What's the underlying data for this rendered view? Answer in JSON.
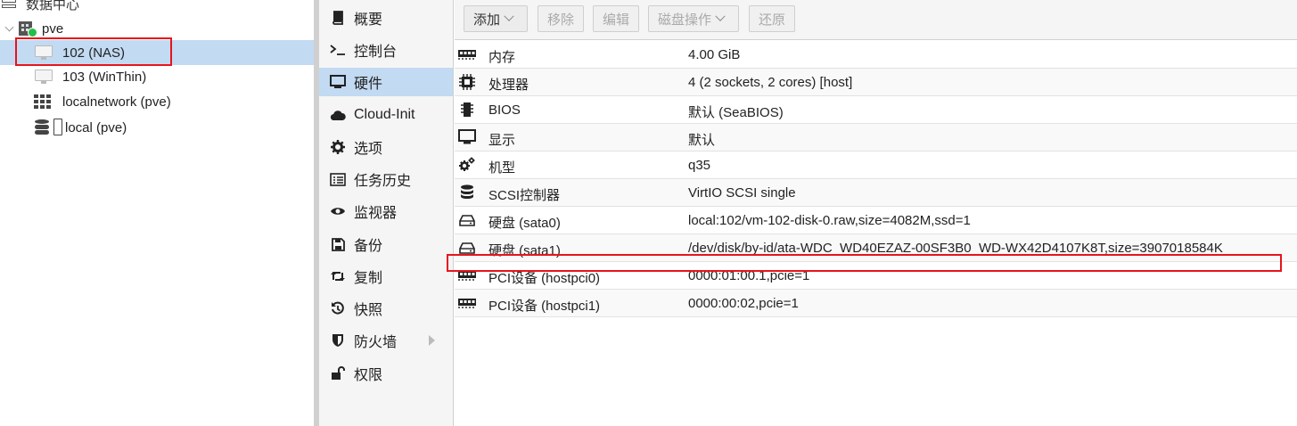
{
  "tree": {
    "datacenter": "数据中心",
    "node": "pve",
    "vm_selected": "102 (NAS)",
    "vm2": "103 (WinThin)",
    "network": "localnetwork (pve)",
    "storage": "local (pve)"
  },
  "nav": {
    "items": [
      {
        "label": "概要",
        "icon": "book-icon"
      },
      {
        "label": "控制台",
        "icon": "terminal-icon"
      },
      {
        "label": "硬件",
        "icon": "monitor-icon"
      },
      {
        "label": "Cloud-Init",
        "icon": "cloud-icon"
      },
      {
        "label": "选项",
        "icon": "gear-icon"
      },
      {
        "label": "任务历史",
        "icon": "list-icon"
      },
      {
        "label": "监视器",
        "icon": "eye-icon"
      },
      {
        "label": "备份",
        "icon": "floppy-icon"
      },
      {
        "label": "复制",
        "icon": "retweet-icon"
      },
      {
        "label": "快照",
        "icon": "history-icon"
      },
      {
        "label": "防火墙",
        "icon": "shield-icon"
      },
      {
        "label": "权限",
        "icon": "unlock-icon"
      }
    ],
    "active_index": 2
  },
  "toolbar": {
    "add": "添加",
    "remove": "移除",
    "edit": "编辑",
    "disk_action": "磁盘操作",
    "revert": "还原"
  },
  "hardware": {
    "rows": [
      {
        "key": "内存",
        "value": "4.00 GiB",
        "icon": "memory-icon"
      },
      {
        "key": "处理器",
        "value": "4 (2 sockets, 2 cores) [host]",
        "icon": "cpu-icon"
      },
      {
        "key": "BIOS",
        "value": "默认 (SeaBIOS)",
        "icon": "bios-chip-icon"
      },
      {
        "key": "显示",
        "value": "默认",
        "icon": "display-icon"
      },
      {
        "key": "机型",
        "value": "q35",
        "icon": "cogs-icon"
      },
      {
        "key": "SCSI控制器",
        "value": "VirtIO SCSI single",
        "icon": "database-icon"
      },
      {
        "key": "硬盘 (sata0)",
        "value": "local:102/vm-102-disk-0.raw,size=4082M,ssd=1",
        "icon": "hdd-icon"
      },
      {
        "key": "硬盘 (sata1)",
        "value": "/dev/disk/by-id/ata-WDC_WD40EZAZ-00SF3B0_WD-WX42D4107K8T,size=3907018584K",
        "icon": "hdd-icon"
      },
      {
        "key": "PCI设备 (hostpci0)",
        "value": "0000:01:00.1,pcie=1",
        "icon": "pci-card-icon"
      },
      {
        "key": "PCI设备 (hostpci1)",
        "value": "0000:00:02,pcie=1",
        "icon": "pci-card-icon"
      }
    ]
  },
  "colors": {
    "selection": "#c2daf2",
    "annotation": "#e8141b",
    "status_ok": "#21bf4b"
  }
}
